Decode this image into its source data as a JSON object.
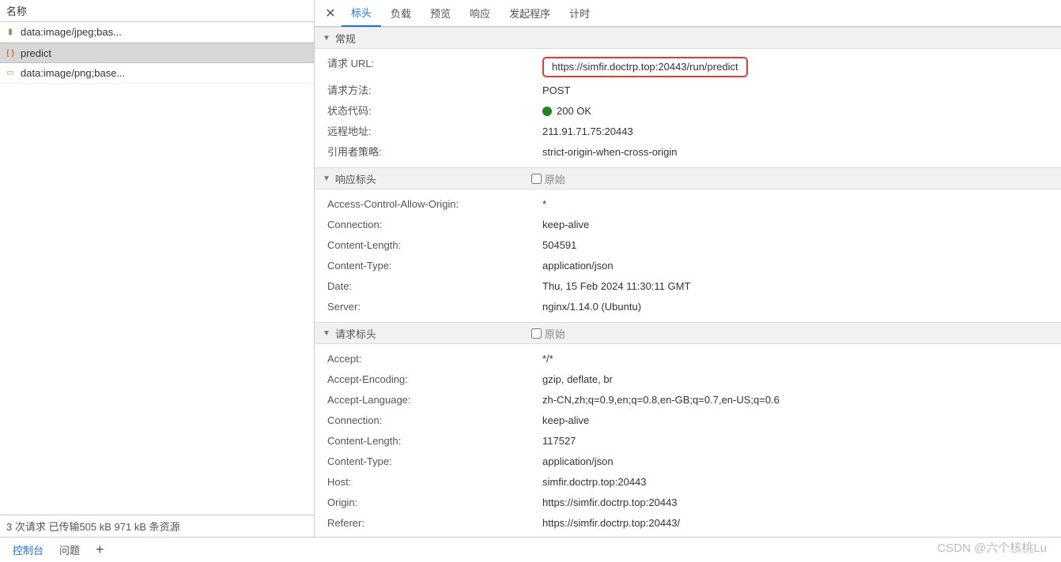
{
  "left": {
    "header": "名称",
    "items": [
      {
        "icon": "img",
        "label": "data:image/jpeg;bas..."
      },
      {
        "icon": "fetch",
        "label": "predict"
      },
      {
        "icon": "img",
        "label": "data:image/png;base..."
      }
    ],
    "footer": "3 次请求  已传输505 kB  971 kB 条资源"
  },
  "tabs": {
    "items": [
      "标头",
      "负载",
      "预览",
      "响应",
      "发起程序",
      "计时"
    ],
    "active": 0
  },
  "sections": {
    "general": {
      "title": "常规",
      "rows": [
        {
          "k": "请求 URL:",
          "v": "https://simfir.doctrp.top:20443/run/predict",
          "hl": true
        },
        {
          "k": "请求方法:",
          "v": "POST"
        },
        {
          "k": "状态代码:",
          "v": "200 OK",
          "status": true
        },
        {
          "k": "远程地址:",
          "v": "211.91.71.75:20443"
        },
        {
          "k": "引用者策略:",
          "v": "strict-origin-when-cross-origin"
        }
      ]
    },
    "response": {
      "title": "响应标头",
      "raw": "原始",
      "rows": [
        {
          "k": "Access-Control-Allow-Origin:",
          "v": "*"
        },
        {
          "k": "Connection:",
          "v": "keep-alive"
        },
        {
          "k": "Content-Length:",
          "v": "504591"
        },
        {
          "k": "Content-Type:",
          "v": "application/json"
        },
        {
          "k": "Date:",
          "v": "Thu, 15 Feb 2024 11:30:11 GMT"
        },
        {
          "k": "Server:",
          "v": "nginx/1.14.0 (Ubuntu)"
        }
      ]
    },
    "request": {
      "title": "请求标头",
      "raw": "原始",
      "rows": [
        {
          "k": "Accept:",
          "v": "*/*"
        },
        {
          "k": "Accept-Encoding:",
          "v": "gzip, deflate, br"
        },
        {
          "k": "Accept-Language:",
          "v": "zh-CN,zh;q=0.9,en;q=0.8,en-GB;q=0.7,en-US;q=0.6"
        },
        {
          "k": "Connection:",
          "v": "keep-alive"
        },
        {
          "k": "Content-Length:",
          "v": "117527"
        },
        {
          "k": "Content-Type:",
          "v": "application/json"
        },
        {
          "k": "Host:",
          "v": "simfir.doctrp.top:20443"
        },
        {
          "k": "Origin:",
          "v": "https://simfir.doctrp.top:20443"
        },
        {
          "k": "Referer:",
          "v": "https://simfir.doctrp.top:20443/"
        }
      ]
    }
  },
  "bottom": {
    "console": "控制台",
    "issues": "问题"
  },
  "watermark": "CSDN @六个核桃Lu"
}
